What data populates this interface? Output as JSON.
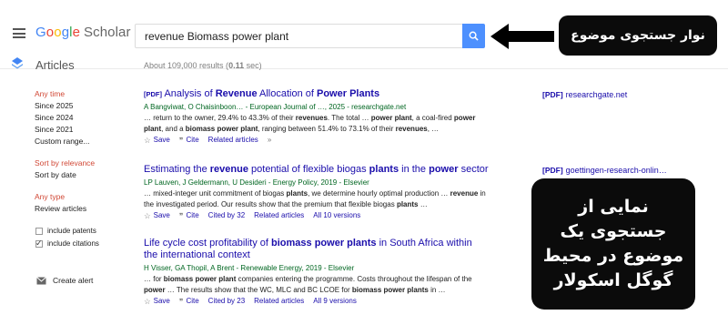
{
  "header": {
    "logo": {
      "google": [
        "G",
        "o",
        "o",
        "g",
        "l",
        "e"
      ],
      "scholar": "Scholar"
    },
    "search": {
      "value": "revenue Biomass power plant"
    },
    "callout": "نوار جستجوی موضوع"
  },
  "subheader": {
    "section_label": "Articles",
    "result_count_prefix": "About 109,000 results (",
    "result_count_time": "0.11",
    "result_count_suffix": " sec)"
  },
  "sidebar": {
    "time_heading": "Any time",
    "time_items": [
      "Since 2025",
      "Since 2024",
      "Since 2021",
      "Custom range..."
    ],
    "sort_heading": "Sort by relevance",
    "sort_items": [
      "Sort by date"
    ],
    "type_heading": "Any type",
    "type_items": [
      "Review articles"
    ],
    "checkboxes": [
      {
        "label": "include patents",
        "checked": false
      },
      {
        "label": "include citations",
        "checked": true
      }
    ],
    "create_alert": "Create alert"
  },
  "results": [
    {
      "pdf_tag": "[PDF]",
      "title_parts": [
        {
          "t": "Analysis of ",
          "b": false
        },
        {
          "t": "Revenue",
          "b": true
        },
        {
          "t": " Allocation of ",
          "b": false
        },
        {
          "t": "Power Plants",
          "b": true
        }
      ],
      "authors": "A Bangviwat, O Chaisinboon… - European Journal of …, 2025 - researchgate.net",
      "snippet_parts": [
        {
          "t": "… return to the owner, 29.4% to 43.3% of their ",
          "b": false
        },
        {
          "t": "revenues",
          "b": true
        },
        {
          "t": ". The total … ",
          "b": false
        },
        {
          "t": "power plant",
          "b": true
        },
        {
          "t": ", a coal-fired ",
          "b": false
        },
        {
          "t": "power plant",
          "b": true
        },
        {
          "t": ", and a ",
          "b": false
        },
        {
          "t": "biomass power plant",
          "b": true
        },
        {
          "t": ", ranging between 51.4% to 73.1% of their ",
          "b": false
        },
        {
          "t": "revenues",
          "b": true
        },
        {
          "t": ", …",
          "b": false
        }
      ],
      "actions": {
        "save": "Save",
        "cite": "Cite",
        "cited_by": "",
        "related": "Related articles",
        "versions": ""
      },
      "side_link": {
        "tag": "[PDF]",
        "source": "researchgate.net"
      }
    },
    {
      "pdf_tag": "",
      "title_parts": [
        {
          "t": "Estimating the ",
          "b": false
        },
        {
          "t": "revenue",
          "b": true
        },
        {
          "t": " potential of flexible biogas ",
          "b": false
        },
        {
          "t": "plants",
          "b": true
        },
        {
          "t": " in the ",
          "b": false
        },
        {
          "t": "power",
          "b": true
        },
        {
          "t": " sector",
          "b": false
        }
      ],
      "authors": "LP Lauven, J Geldermann, U Desideri - Energy Policy, 2019 - Elsevier",
      "snippet_parts": [
        {
          "t": "… mixed-integer unit commitment of biogas ",
          "b": false
        },
        {
          "t": "plants",
          "b": true
        },
        {
          "t": ", we determine hourly optimal production … ",
          "b": false
        },
        {
          "t": "revenue",
          "b": true
        },
        {
          "t": " in the investigated period. Our results show that the premium that flexible biogas ",
          "b": false
        },
        {
          "t": "plants",
          "b": true
        },
        {
          "t": " …",
          "b": false
        }
      ],
      "actions": {
        "save": "Save",
        "cite": "Cite",
        "cited_by": "Cited by 32",
        "related": "Related articles",
        "versions": "All 10 versions"
      },
      "side_link": {
        "tag": "[PDF]",
        "source": "goettingen-research-onlin…"
      }
    },
    {
      "pdf_tag": "",
      "title_parts": [
        {
          "t": "Life cycle cost profitability of ",
          "b": false
        },
        {
          "t": "biomass power plants",
          "b": true
        },
        {
          "t": " in South Africa within the international context",
          "b": false
        }
      ],
      "authors": "H Visser, GA Thopil, A Brent - Renewable Energy, 2019 - Elsevier",
      "snippet_parts": [
        {
          "t": "… for ",
          "b": false
        },
        {
          "t": "biomass power plant",
          "b": true
        },
        {
          "t": " companies entering the programme. Costs throughout the lifespan of the ",
          "b": false
        },
        {
          "t": "power",
          "b": true
        },
        {
          "t": " … The results show that the WC, MLC and BC LCOE for ",
          "b": false
        },
        {
          "t": "biomass power plants",
          "b": true
        },
        {
          "t": " in …",
          "b": false
        }
      ],
      "actions": {
        "save": "Save",
        "cite": "Cite",
        "cited_by": "Cited by 23",
        "related": "Related articles",
        "versions": "All 9 versions"
      },
      "side_link": null
    }
  ],
  "callout_big": "نمایی از جستجوی یک موضوع در محیط گوگل اسکولار",
  "colors": {
    "accent": "#4d90fe",
    "link": "#1a0dab",
    "author_green": "#006621",
    "sidebar_red": "#d14836",
    "callout_bg": "#0b0b0b"
  },
  "icons": [
    "menu-icon",
    "search-icon",
    "arrow-left-icon",
    "articles-icon",
    "star-icon",
    "quote-icon",
    "more-icon",
    "mail-icon"
  ]
}
